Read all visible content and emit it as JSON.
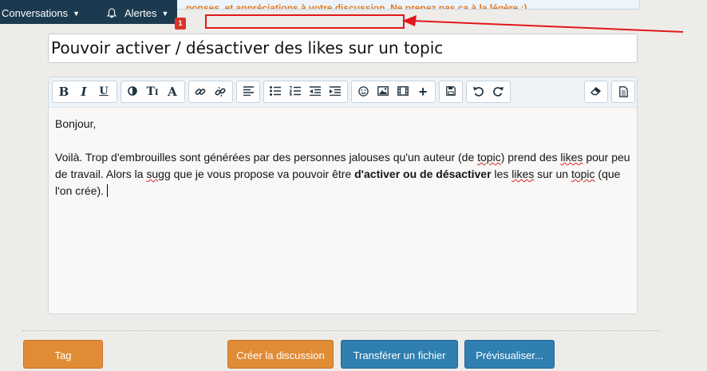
{
  "notice": {
    "text": "ponses, et appréciations à votre discussion. Ne prenez pas ça à la légère :)"
  },
  "topbar": {
    "conversations_label": "Conversations",
    "alerts_label": "Alertes",
    "alerts_badge": "1"
  },
  "thread": {
    "title_value": "Pouvoir activer / désactiver des likes sur un topic"
  },
  "toolbar": {
    "icons": [
      "bold-icon",
      "italic-icon",
      "underline-icon",
      "text-color-icon",
      "font-size-icon",
      "font-family-icon",
      "link-icon",
      "unlink-icon",
      "align-icon",
      "bullet-list-icon",
      "numbered-list-icon",
      "outdent-icon",
      "indent-icon",
      "smilie-icon",
      "image-icon",
      "media-icon",
      "insert-more-icon",
      "save-draft-icon",
      "undo-icon",
      "redo-icon",
      "remove-format-icon",
      "toggle-bbcode-icon"
    ]
  },
  "editor": {
    "greeting": "Bonjour,",
    "body_1": "Voilà. Trop d'embrouilles sont générées par des personnes jalouses qu'un auteur (de ",
    "w_topic_1": "topic",
    "body_2": ") prend des ",
    "w_likes_1": "likes",
    "body_3": " pour peu de travail. Alors la ",
    "w_sugg": "sugg",
    "body_4": " que je vous propose va pouvoir être ",
    "bold_phrase": "d'activer ou de désactiver",
    "body_5": " les ",
    "w_likes_2": "likes",
    "body_6": " sur un ",
    "w_topic_2": "topic",
    "body_7": " (que l'on crée)."
  },
  "buttons": {
    "tags": "Tag",
    "create": "Créer la discussion",
    "upload": "Transférer un fichier",
    "preview": "Prévisualiser..."
  },
  "colors": {
    "topbar": "#1c3a4f",
    "accent_orange": "#e08c36",
    "accent_blue": "#2f7fb0",
    "annotation_red": "#e0191b"
  }
}
